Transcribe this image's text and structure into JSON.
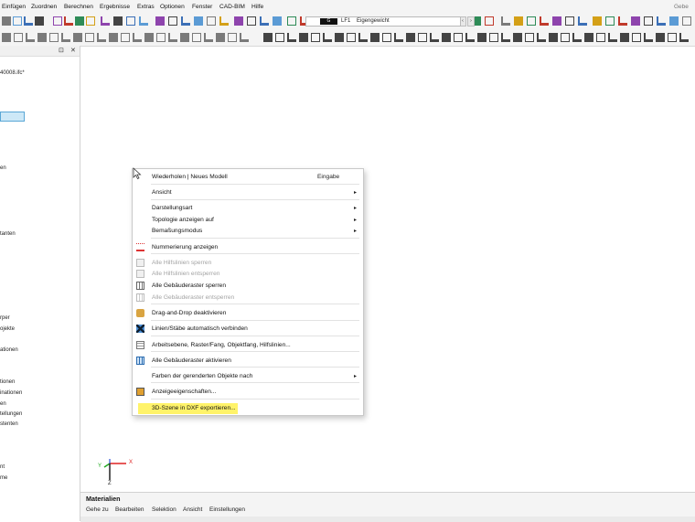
{
  "menubar": {
    "items": [
      "Einfügen",
      "Zuordnen",
      "Berechnen",
      "Ergebnisse",
      "Extras",
      "Optionen",
      "Fenster",
      "CAD-BIM",
      "Hilfe"
    ],
    "right_text": "Gebe"
  },
  "toolbar": {
    "loadcase_box": "G",
    "loadcase_number": "LF1",
    "loadcase_name": "Eigengewicht",
    "prev_symbol": "‹",
    "next_symbol": "›"
  },
  "left_panel": {
    "pin_symbol": "⊡",
    "close_symbol": "✕",
    "items": [
      {
        "text": "40008.ifc*",
        "row": 0
      },
      {
        "text": "en",
        "row": 1
      },
      {
        "text": "tanten",
        "row": 2
      },
      {
        "text": "rper",
        "row": 3
      },
      {
        "text": "ojekte",
        "row": 4
      },
      {
        "text": "ationen",
        "row": 5
      },
      {
        "text": "tionen",
        "row": 6
      },
      {
        "text": "inationen",
        "row": 7
      },
      {
        "text": "en",
        "row": 8
      },
      {
        "text": "tellungen",
        "row": 9
      },
      {
        "text": "stenten",
        "row": 10
      },
      {
        "text": "nt",
        "row": 11
      },
      {
        "text": "me",
        "row": 12
      }
    ]
  },
  "context_menu": {
    "items": [
      {
        "label": "Wiederholen | Neues Modell",
        "shortcut": "Eingabe",
        "submenu": false,
        "disabled": false,
        "icon": "none"
      },
      {
        "label": "Ansicht",
        "shortcut": "",
        "submenu": true,
        "disabled": false,
        "icon": "none"
      },
      {
        "label": "Darstellungsart",
        "shortcut": "",
        "submenu": true,
        "disabled": false,
        "icon": "none"
      },
      {
        "label": "Topologie anzeigen auf",
        "shortcut": "",
        "submenu": true,
        "disabled": false,
        "icon": "none"
      },
      {
        "label": "Bemaßungsmodus",
        "shortcut": "",
        "submenu": true,
        "disabled": false,
        "icon": "none"
      },
      {
        "label": "Nummerierung anzeigen",
        "shortcut": "",
        "submenu": false,
        "disabled": false,
        "icon": "numbering-icon"
      },
      {
        "label": "Alle Hilfslinien sperren",
        "shortcut": "",
        "submenu": false,
        "disabled": true,
        "icon": "lock-guidelines-icon"
      },
      {
        "label": "Alle Hilfslinien entsperren",
        "shortcut": "",
        "submenu": false,
        "disabled": true,
        "icon": "unlock-guidelines-icon"
      },
      {
        "label": "Alle Gebäuderaster sperren",
        "shortcut": "",
        "submenu": false,
        "disabled": false,
        "icon": "lock-grid-icon"
      },
      {
        "label": "Alle Gebäuderaster entsperren",
        "shortcut": "",
        "submenu": false,
        "disabled": true,
        "icon": "unlock-grid-icon"
      },
      {
        "label": "Drag-and-Drop deaktivieren",
        "shortcut": "",
        "submenu": false,
        "disabled": false,
        "icon": "drag-drop-icon"
      },
      {
        "label": "Linien/Stäbe automatisch verbinden",
        "shortcut": "",
        "submenu": false,
        "disabled": false,
        "icon": "connect-lines-icon"
      },
      {
        "label": "Arbeitsebene, Raster/Fang, Objektfang, Hilfslinien...",
        "shortcut": "",
        "submenu": false,
        "disabled": false,
        "icon": "work-plane-icon"
      },
      {
        "label": "Alle Gebäuderaster aktivieren",
        "shortcut": "",
        "submenu": false,
        "disabled": false,
        "icon": "activate-grid-icon"
      },
      {
        "label": "Farben der gerenderten Objekte nach",
        "shortcut": "",
        "submenu": true,
        "disabled": false,
        "icon": "none"
      },
      {
        "label": "Anzeigeeigenschaften...",
        "shortcut": "",
        "submenu": false,
        "disabled": false,
        "icon": "display-properties-icon"
      },
      {
        "label": "3D-Szene in DXF exportieren...",
        "shortcut": "",
        "submenu": false,
        "disabled": false,
        "icon": "none",
        "highlighted": true
      }
    ],
    "highlight_color": "#fff36a"
  },
  "axes": {
    "x_label": "X",
    "y_label": "Y",
    "z_label": "Z"
  },
  "bottom_panel": {
    "title": "Materialien",
    "menu": [
      "Gehe zu",
      "Bearbeiten",
      "Selektion",
      "Ansicht",
      "Einstellungen"
    ]
  }
}
